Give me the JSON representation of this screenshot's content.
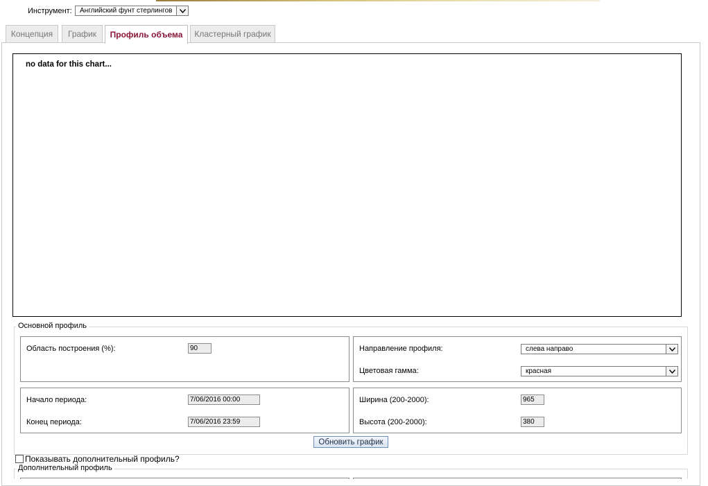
{
  "header": {
    "instrument_label": "Инструмент:",
    "instrument_value": "Английский фунт стерлингов"
  },
  "tabs": [
    {
      "label": "Концепция",
      "active": false
    },
    {
      "label": "График",
      "active": false
    },
    {
      "label": "Профиль объема",
      "active": true
    },
    {
      "label": "Кластерный график",
      "active": false
    }
  ],
  "chart": {
    "message": "no data for this chart..."
  },
  "main_profile": {
    "legend": "Основной профиль",
    "area_label": "Область построения (%):",
    "area_value": "90",
    "direction_label": "Направление профиля:",
    "direction_value": "слева направо",
    "color_label": "Цветовая гамма:",
    "color_value": "красная",
    "start_label": "Начало периода:",
    "start_value": "7/06/2016 00:00",
    "end_label": "Конец периода:",
    "end_value": "7/06/2016 23:59",
    "width_label": "Ширина (200-2000):",
    "width_value": "965",
    "height_label": "Высота (200-2000):",
    "height_value": "380",
    "update_button": "Обновить график"
  },
  "extra_profile": {
    "checkbox_label": "Показывать дополнительный профиль?",
    "checked": false,
    "legend": "Дополнительный профиль"
  },
  "colors": {
    "active_tab_text": "#8a1538",
    "inactive_tab_bg": "#ececec",
    "button_border": "#6d8fb8"
  }
}
